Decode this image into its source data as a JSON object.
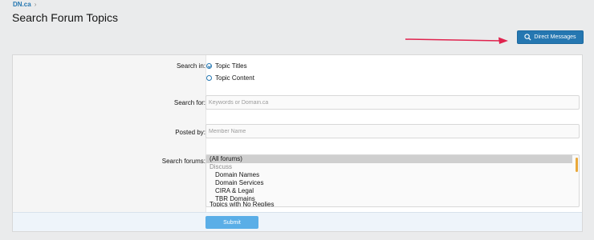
{
  "breadcrumb": {
    "site": "DN.ca"
  },
  "page": {
    "title": "Search Forum Topics"
  },
  "header": {
    "direct_messages_label": "Direct Messages"
  },
  "form": {
    "search_in": {
      "label": "Search in:",
      "options": [
        "Topic Titles",
        "Topic Content"
      ],
      "selected": "Topic Titles"
    },
    "search_for": {
      "label": "Search for:",
      "placeholder": "Keywords or Domain.ca",
      "value": ""
    },
    "posted_by": {
      "label": "Posted by:",
      "placeholder": "Member Name",
      "value": ""
    },
    "search_forums": {
      "label": "Search forums:",
      "options": [
        "(All forums)",
        "Discuss",
        "Domain Names",
        "Domain Services",
        "CIRA & Legal",
        "TBR Domains",
        "Topics with No Replies"
      ],
      "selected": "(All forums)"
    },
    "submit_label": "Submit"
  },
  "colors": {
    "accent": "#2577b1",
    "submit": "#5aaee7",
    "annotation_arrow": "#e0234e",
    "scrollbar": "#e9a83a"
  }
}
